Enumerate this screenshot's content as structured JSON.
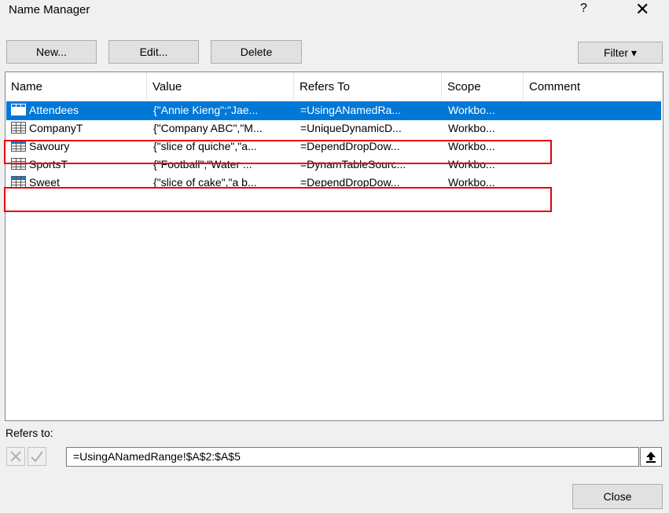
{
  "window": {
    "title": "Name Manager",
    "help_label": "?",
    "close_label": "✕"
  },
  "toolbar": {
    "new_label": "New...",
    "edit_label": "Edit...",
    "delete_label": "Delete",
    "filter_label": "Filter ▾"
  },
  "table": {
    "columns": [
      "Name",
      "Value",
      "Refers To",
      "Scope",
      "Comment"
    ],
    "rows": [
      {
        "name": "Attendees",
        "value": "{\"Annie Kieng\";\"Jae...",
        "refers_to": "=UsingANamedRa...",
        "scope": "Workbo...",
        "comment": "",
        "selected": true
      },
      {
        "name": "CompanyT",
        "value": "{\"Company ABC\",\"M...",
        "refers_to": "=UniqueDynamicD...",
        "scope": "Workbo...",
        "comment": "",
        "selected": false
      },
      {
        "name": "Savoury",
        "value": "{\"slice of quiche\",\"a...",
        "refers_to": "=DependDropDow...",
        "scope": "Workbo...",
        "comment": "",
        "selected": false
      },
      {
        "name": "SportsT",
        "value": "{\"Football\";\"Water ...",
        "refers_to": "=DynamTableSourc...",
        "scope": "Workbo...",
        "comment": "",
        "selected": false
      },
      {
        "name": "Sweet",
        "value": "{\"slice of cake\",\"a b...",
        "refers_to": "=DependDropDow...",
        "scope": "Workbo...",
        "comment": "",
        "selected": false
      }
    ]
  },
  "refers": {
    "label": "Refers to:",
    "value": "=UsingANamedRange!$A$2:$A$5"
  },
  "footer": {
    "close_label": "Close"
  },
  "colors": {
    "selection": "#0078d7",
    "highlight_border": "#e8000b",
    "table_icon": "#1e7bd4"
  }
}
